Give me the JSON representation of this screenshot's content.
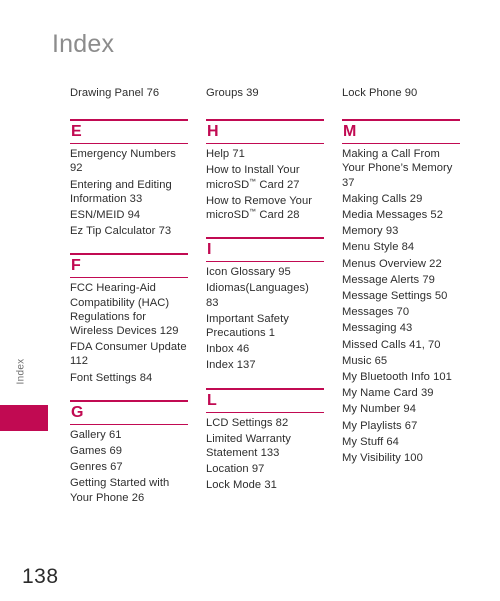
{
  "page": {
    "title": "Index",
    "number": "138",
    "side_tab_label": "Index",
    "accent_color": "#c10a52",
    "title_color": "#8c8c8c",
    "text_color": "#2e2e2e"
  },
  "columns": [
    {
      "orphan_entries": [
        "Drawing Panel 76"
      ],
      "sections": [
        {
          "letter": "E",
          "entries": [
            "Emergency Numbers 92",
            "Entering and Editing Information 33",
            "ESN/MEID 94",
            "Ez Tip Calculator 73"
          ]
        },
        {
          "letter": "F",
          "entries": [
            "FCC Hearing-Aid Compatibility (HAC) Regulations for Wireless Devices 129",
            "FDA Consumer Update 112",
            "Font Settings 84"
          ]
        },
        {
          "letter": "G",
          "entries": [
            "Gallery 61",
            "Games 69",
            "Genres 67",
            "Getting Started with Your Phone 26"
          ]
        }
      ]
    },
    {
      "orphan_entries": [
        "Groups 39"
      ],
      "sections": [
        {
          "letter": "H",
          "entries": [
            "Help 71",
            "How to Install Your microSD™ Card 27",
            "How to Remove Your microSD™ Card 28"
          ]
        },
        {
          "letter": "I",
          "entries": [
            "Icon Glossary 95",
            "Idiomas(Languages) 83",
            "Important Safety Precautions 1",
            "Inbox 46",
            "Index 137"
          ]
        },
        {
          "letter": "L",
          "entries": [
            "LCD Settings 82",
            "Limited Warranty Statement 133",
            "Location 97",
            "Lock Mode 31"
          ]
        }
      ]
    },
    {
      "orphan_entries": [
        "Lock Phone 90"
      ],
      "sections": [
        {
          "letter": "M",
          "entries": [
            "Making a Call From Your Phone’s Memory 37",
            "Making Calls 29",
            "Media Messages 52",
            "Memory 93",
            "Menu Style 84",
            "Menus Overview 22",
            "Message Alerts 79",
            "Message Settings 50",
            "Messages 70",
            "Messaging 43",
            "Missed Calls 41, 70",
            "Music 65",
            "My Bluetooth Info 101",
            "My Name Card 39",
            "My Number 94",
            "My Playlists 67",
            "My Stuff 64",
            "My Visibility 100"
          ]
        }
      ]
    }
  ]
}
